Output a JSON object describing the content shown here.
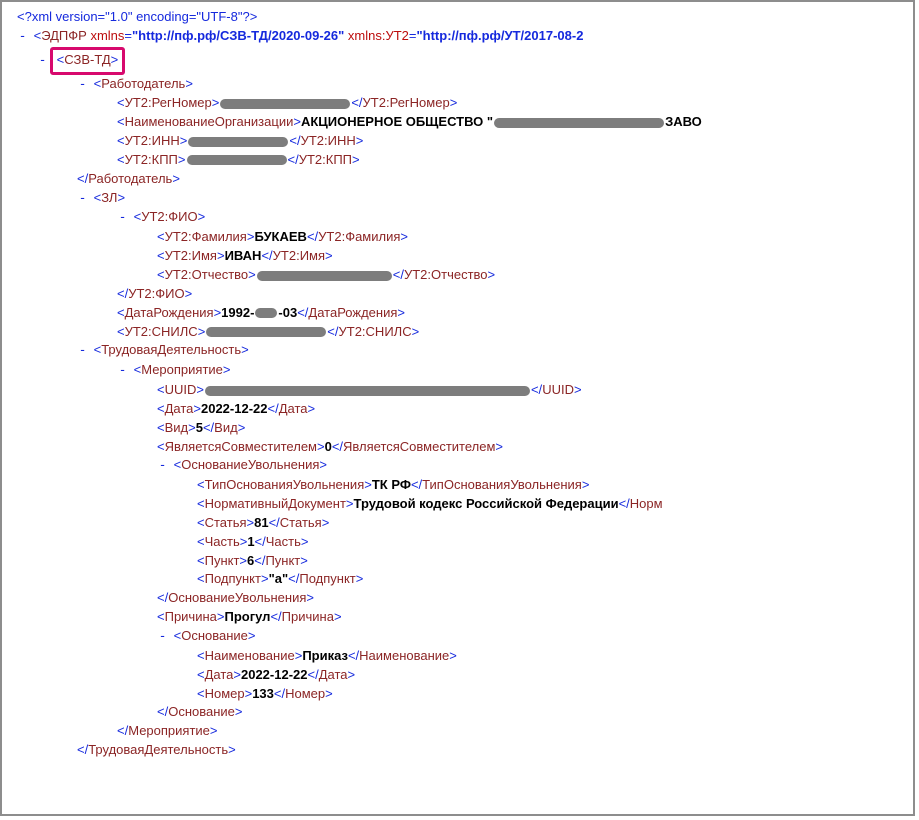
{
  "xmlDecl": "<?xml version=\"1.0\" encoding=\"UTF-8\"?>",
  "root": {
    "name": "ЭДПФР",
    "attr1": "xmlns",
    "ns1": "\"http://пф.рф/СЗВ-ТД/2020-09-26\"",
    "attr2": "xmlns:УТ2",
    "ns2": "\"http://пф.рф/УТ/2017-08-2"
  },
  "szv": "СЗВ-ТД",
  "employer": {
    "open": "Работодатель",
    "close": "Работодатель"
  },
  "regOpen": "УТ2:РегНомер",
  "regClose": "УТ2:РегНомер",
  "orgOpen": "НаименованиеОрганизации",
  "orgVal": "АКЦИОНЕРНОЕ ОБЩЕСТВО \"",
  "orgSuffix": "ЗАВО",
  "orgClose": "НаименованиеОрганизации",
  "innOpen": "УТ2:ИНН",
  "innClose": "УТ2:ИНН",
  "kppOpen": "УТ2:КПП",
  "kppClose": "УТ2:КПП",
  "zl": "ЗЛ",
  "fio": "УТ2:ФИО",
  "famOpen": "УТ2:Фамилия",
  "famVal": "БУКАЕВ",
  "famClose": "УТ2:Фамилия",
  "nameOpen": "УТ2:Имя",
  "nameVal": "ИВАН",
  "nameClose": "УТ2:Имя",
  "patOpen": "УТ2:Отчество",
  "patClose": "УТ2:Отчество",
  "dobOpen": "ДатаРождения",
  "dobVal1": "1992-",
  "dobVal2": "-03",
  "dobClose": "ДатаРождения",
  "snilsOpen": "УТ2:СНИЛС",
  "snilsClose": "УТ2:СНИЛС",
  "work": "ТрудоваяДеятельность",
  "event": "Мероприятие",
  "uuidOpen": "UUID",
  "uuidClose": "UUID",
  "dateOpen": "Дата",
  "dateVal": "2022-12-22",
  "dateClose": "Дата",
  "vidOpen": "Вид",
  "vidVal": "5",
  "vidClose": "Вид",
  "sovOpen": "ЯвляетсяСовместителем",
  "sovVal": "0",
  "sovClose": "ЯвляетсяСовместителем",
  "dismiss": "ОснованиеУвольнения",
  "typeOpen": "ТипОснованияУвольнения",
  "typeVal": "ТК РФ",
  "typeClose": "ТипОснованияУвольнения",
  "normOpen": "НормативныйДокумент",
  "normVal": "Трудовой кодекс Российской Федерации",
  "normClose": "Норм",
  "stOpen": "Статья",
  "stVal": "81",
  "stClose": "Статья",
  "chOpen": "Часть",
  "chVal": "1",
  "chClose": "Часть",
  "pnOpen": "Пункт",
  "pnVal": "6",
  "pnClose": "Пункт",
  "spOpen": "Подпункт",
  "spVal": "\"а\"",
  "spClose": "Подпункт",
  "reasonOpen": "Причина",
  "reasonVal": "Прогул",
  "reasonClose": "Причина",
  "basis": "Основание",
  "bnameOpen": "Наименование",
  "bnameVal": "Приказ",
  "bnameClose": "Наименование",
  "bdateOpen": "Дата",
  "bdateVal": "2022-12-22",
  "bdateClose": "Дата",
  "bnumOpen": "Номер",
  "bnumVal": "133",
  "bnumClose": "Номер"
}
